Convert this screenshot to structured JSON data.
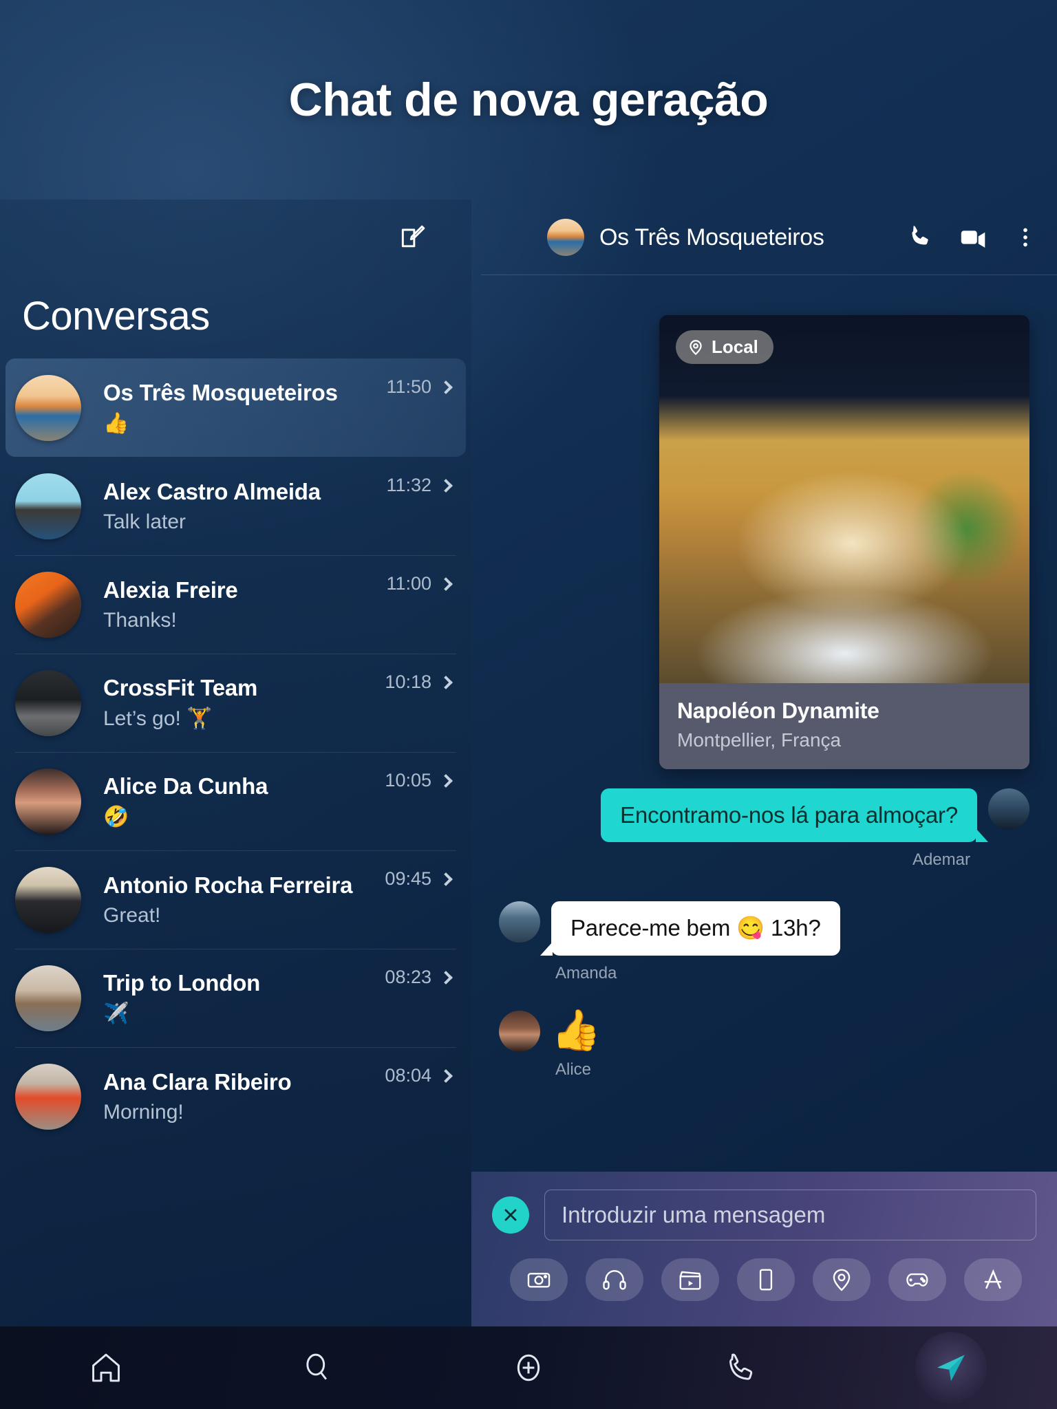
{
  "hero": {
    "title": "Chat de nova geração"
  },
  "sidebar": {
    "compose_icon": "compose-icon",
    "title": "Conversas",
    "items": [
      {
        "name": "Os Três Mosqueteiros",
        "preview": "👍",
        "time": "11:50",
        "avatar": "av-cuba",
        "active": true
      },
      {
        "name": "Alex Castro Almeida",
        "preview": "Talk later",
        "time": "11:32",
        "avatar": "av-alex",
        "active": false
      },
      {
        "name": "Alexia Freire",
        "preview": "Thanks!",
        "time": "11:00",
        "avatar": "av-alexia",
        "active": false
      },
      {
        "name": "CrossFit Team",
        "preview": "Let’s go! 🏋️",
        "time": "10:18",
        "avatar": "av-cross",
        "active": false
      },
      {
        "name": "Alice Da Cunha",
        "preview": "🤣",
        "time": "10:05",
        "avatar": "av-alice",
        "active": false
      },
      {
        "name": "Antonio Rocha Ferreira",
        "preview": "Great!",
        "time": "09:45",
        "avatar": "av-antonio",
        "active": false
      },
      {
        "name": "Trip to London",
        "preview": "✈️",
        "time": "08:23",
        "avatar": "av-london",
        "active": false
      },
      {
        "name": "Ana Clara Ribeiro",
        "preview": "Morning!",
        "time": "08:04",
        "avatar": "av-ana",
        "active": false
      }
    ]
  },
  "chat": {
    "header": {
      "title": "Os Três Mosqueteiros",
      "actions": [
        "phone-icon",
        "video-icon",
        "more-vertical-icon"
      ]
    },
    "location_card": {
      "badge_label": "Local",
      "badge_icon": "map-pin-icon",
      "name": "Napoléon Dynamite",
      "subtitle": "Montpellier, França"
    },
    "messages": [
      {
        "type": "outgoing",
        "text": "Encontramo-nos lá para almoçar?",
        "sender": "Ademar",
        "avatar": "av-ademar"
      },
      {
        "type": "incoming",
        "text": "Parece-me bem 😋 13h?",
        "sender": "Amanda",
        "avatar": "av-amanda"
      },
      {
        "type": "emoji",
        "text": "👍",
        "sender": "Alice",
        "avatar": "av-alice2"
      }
    ]
  },
  "composer": {
    "close_icon": "close-icon",
    "placeholder": "Introduzir uma mensagem",
    "value": "",
    "attachments": [
      {
        "icon": "camera-icon",
        "label": "Câmara"
      },
      {
        "icon": "headphones-icon",
        "label": "Áudio"
      },
      {
        "icon": "clapperboard-icon",
        "label": "Vídeo"
      },
      {
        "icon": "card-icon",
        "label": "Cartão"
      },
      {
        "icon": "map-pin-icon",
        "label": "Localização"
      },
      {
        "icon": "gamepad-icon",
        "label": "Jogos"
      },
      {
        "icon": "appstore-icon",
        "label": "Apps"
      }
    ]
  },
  "bottom_nav": {
    "items": [
      {
        "icon": "home-icon",
        "label": "Início"
      },
      {
        "icon": "search-icon",
        "label": "Pesquisar"
      },
      {
        "icon": "plus-circle-icon",
        "label": "Novo"
      },
      {
        "icon": "phone-icon",
        "label": "Chamadas"
      },
      {
        "icon": "send-icon",
        "label": "Enviar"
      }
    ]
  },
  "colors": {
    "accent_cyan": "#1fd6d0",
    "bg_deep_blue": "#0e2848",
    "bubble_in": "#ffffff",
    "caption_bg": "#565a6c"
  }
}
